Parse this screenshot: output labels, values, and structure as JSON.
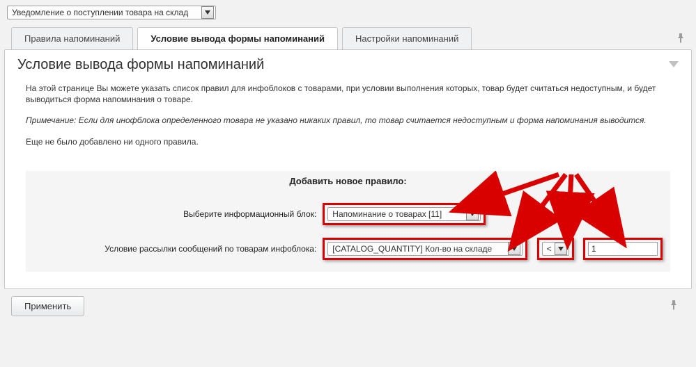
{
  "topSelect": {
    "value": "Уведомление о поступлении товара на склад"
  },
  "tabs": {
    "rules": "Правила напоминаний",
    "conditions": "Условие вывода формы напоминаний",
    "settings": "Настройки напоминаний"
  },
  "panel": {
    "title": "Условие вывода формы напоминаний",
    "p1": "На этой странице Вы можете указать список правил для инфоблоков с товарами, при условии выполнения которых, товар будет считаться недоступным, и будет выводиться форма напоминания о товаре.",
    "p2": "Примечание: Если для инофблока определенного товара не указано никаких правил, то товар считается недоступным и форма напоминания выводится.",
    "p3": "Еще не было добавлено ни одного правила."
  },
  "form": {
    "header": "Добавить новое правило:",
    "row1": {
      "label": "Выберите информационный блок:",
      "selectValue": "Напоминание о товарах [11]"
    },
    "row2": {
      "label": "Условие рассылки сообщений по товарам инфоблока:",
      "fieldSelect": "[CATALOG_QUANTITY] Кол-во на складе",
      "opSelect": "<",
      "textValue": "1"
    }
  },
  "buttons": {
    "apply": "Применить"
  }
}
